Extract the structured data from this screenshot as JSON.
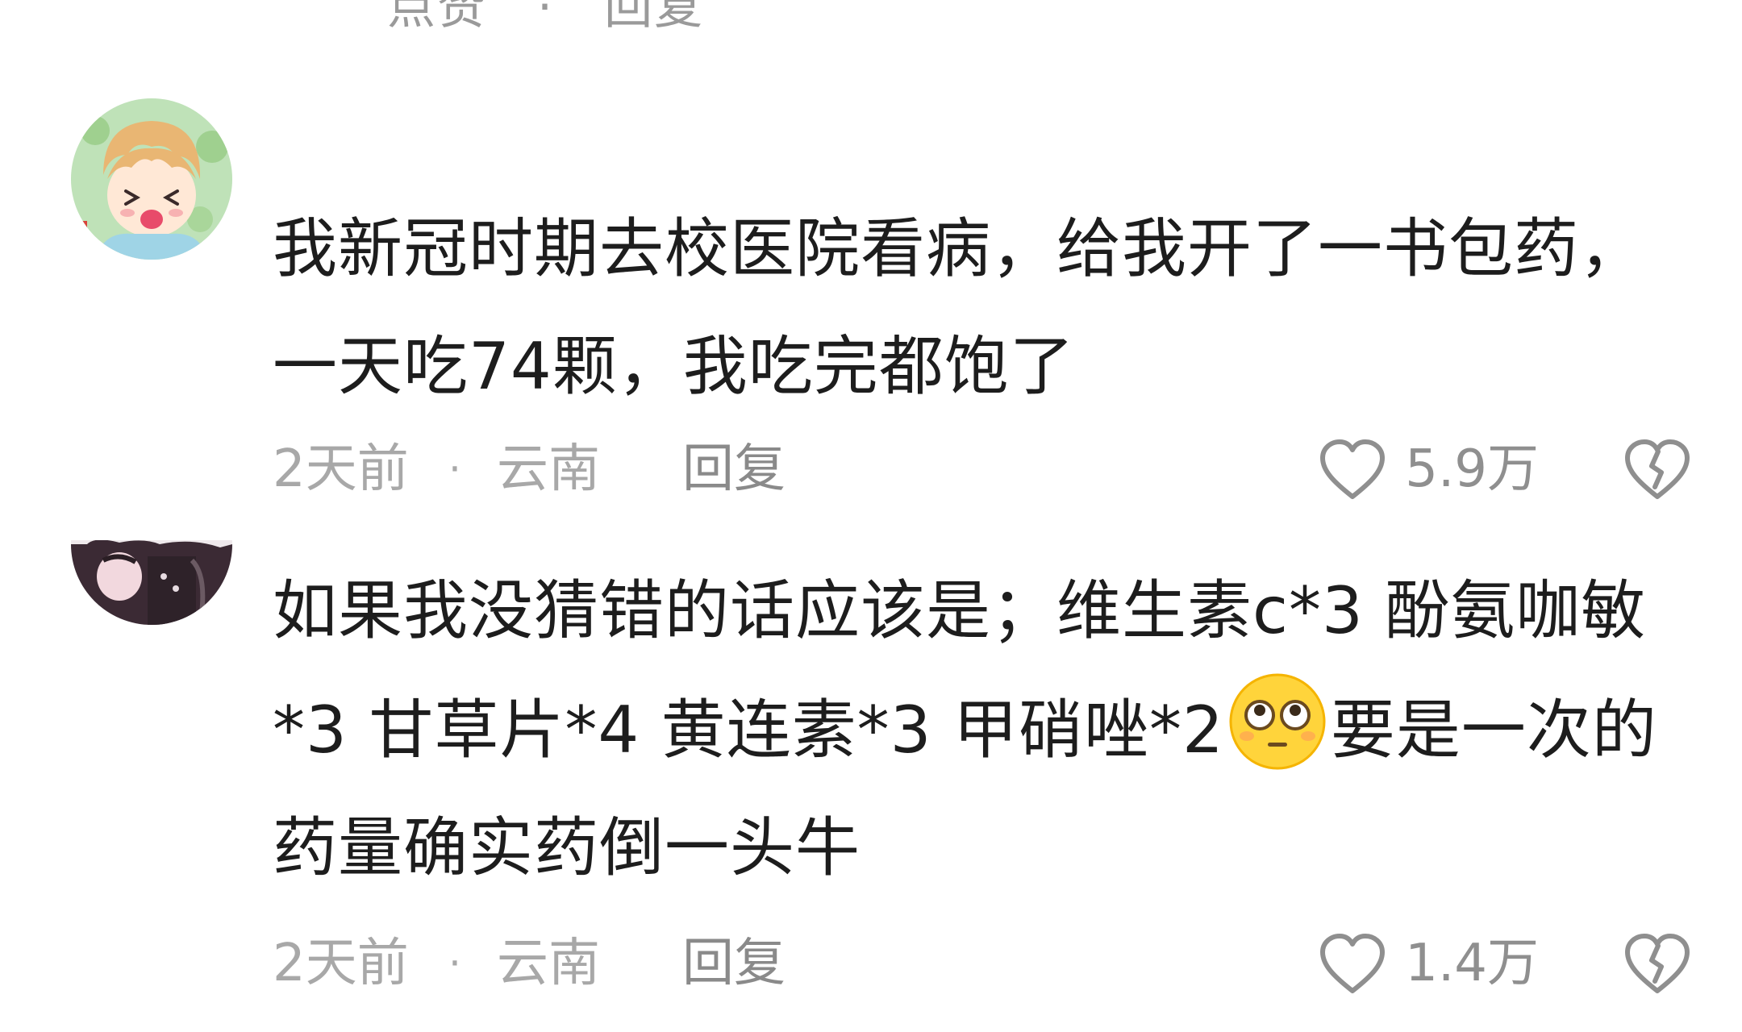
{
  "comments": [
    {
      "text": "我新冠时期去校医院看病，给我开了一书包药，一天吃74颗，我吃完都饱了",
      "time": "2天前",
      "separator": "·",
      "location": "云南",
      "reply_label": "回复",
      "likes": "5.9万"
    },
    {
      "text_part1": "如果我没猜错的话应该是；维生素c*3 酚氨咖敏*3 甘草片*4 黄连素*3 甲硝唑*2",
      "emoji": "flushed-face-emoji",
      "text_part2": "要是一次的药量确实药倒一头牛",
      "time": "2天前",
      "separator": "·",
      "location": "云南",
      "reply_label": "回复",
      "likes": "1.4万"
    }
  ],
  "colors": {
    "text": "#1d1d1d",
    "meta": "#a8a8a8",
    "icon": "#8f8f8f"
  }
}
